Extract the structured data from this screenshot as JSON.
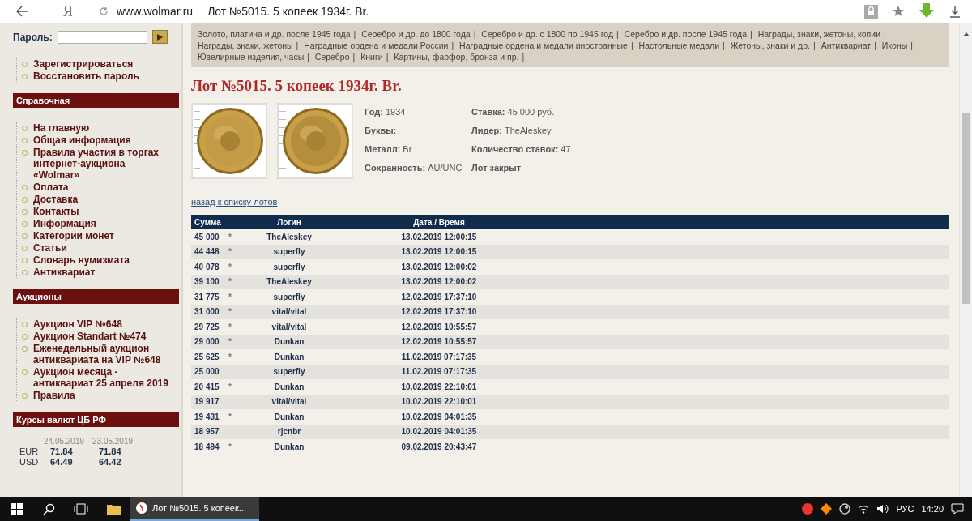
{
  "browser": {
    "logo": "Я",
    "url": "www.wolmar.ru",
    "title": "Лот №5015. 5 копеек 1934г. Br."
  },
  "sidebar": {
    "password_label": "Пароль:",
    "account_links": [
      "Зарегистрироваться",
      "Восстановить пароль"
    ],
    "sections": [
      {
        "title": "Справочная",
        "items": [
          "На главную",
          "Общая информация",
          "Правила участия в торгах интернет-аукциона «Wolmar»",
          "Оплата",
          "Доставка",
          "Контакты",
          "Информация",
          "Категории монет",
          "Статьи",
          "Словарь нумизмата",
          "Антиквариат"
        ]
      },
      {
        "title": "Аукционы",
        "items": [
          "Аукцион VIP №648",
          "Аукцион Standart №474",
          "Еженедельный аукцион антиквариата на VIP №648",
          "Аукцион месяца - антиквариат 25 апреля 2019",
          "Правила"
        ]
      }
    ],
    "rates": {
      "title": "Курсы валют ЦБ РФ",
      "dates": [
        "24.05.2019",
        "23.05.2019"
      ],
      "rows": [
        {
          "currency": "EUR",
          "values": [
            "71.84",
            "71.84"
          ]
        },
        {
          "currency": "USD",
          "values": [
            "64.49",
            "64.42"
          ]
        }
      ]
    }
  },
  "categories": {
    "separator": "|",
    "items": [
      "Золото, платина и др. после 1945 года",
      "Серебро и др. до 1800 года",
      "Серебро и др. с 1800 по 1945 год",
      "Серебро и др. после 1945 года",
      "Награды, знаки, жетоны, копии",
      "Награды, знаки, жетоны",
      "Наградные ордена и медали России",
      "Наградные ордена и медали иностранные",
      "Настольные медали",
      "Жетоны, знаки и др.",
      "Антиквариат",
      "Иконы",
      "Ювелирные изделия, часы",
      "Серебро",
      "Книги",
      "Картины, фарфор, бронза и пр."
    ]
  },
  "lot": {
    "title": "Лот №5015.  5 копеек 1934г. Br.",
    "details_left": [
      {
        "label": "Год:",
        "value": "1934"
      },
      {
        "label": "Буквы:"
      },
      {
        "label": "Металл:",
        "value": "Br"
      },
      {
        "label": "Сохранность:",
        "value": "AU/UNC"
      }
    ],
    "details_right": [
      {
        "label": "Ставка:",
        "value": "45 000 руб."
      },
      {
        "label": "Лидер:",
        "value": "TheAleskey"
      },
      {
        "label": "Количество ставок:",
        "value": "47"
      },
      {
        "label": "Лот закрыт"
      }
    ],
    "back_link": "назад к списку лотов"
  },
  "bids": {
    "columns": [
      "Сумма",
      "Логин",
      "Дата / Время"
    ],
    "rows": [
      {
        "amount": "45 000",
        "star": "*",
        "login": "TheAleskey",
        "datetime": "13.02.2019 12:00:15"
      },
      {
        "amount": "44 448",
        "star": "*",
        "login": "superfly",
        "datetime": "13.02.2019 12:00:15"
      },
      {
        "amount": "40 078",
        "star": "*",
        "login": "superfly",
        "datetime": "13.02.2019 12:00:02"
      },
      {
        "amount": "39 100",
        "star": "*",
        "login": "TheAleskey",
        "datetime": "13.02.2019 12:00:02"
      },
      {
        "amount": "31 775",
        "star": "*",
        "login": "superfly",
        "datetime": "12.02.2019 17:37:10"
      },
      {
        "amount": "31 000",
        "star": "*",
        "login": "vital/vital",
        "datetime": "12.02.2019 17:37:10"
      },
      {
        "amount": "29 725",
        "star": "*",
        "login": "vital/vital",
        "datetime": "12.02.2019 10:55:57"
      },
      {
        "amount": "29 000",
        "star": "*",
        "login": "Dunkan",
        "datetime": "12.02.2019 10:55:57"
      },
      {
        "amount": "25 625",
        "star": "*",
        "login": "Dunkan",
        "datetime": "11.02.2019 07:17:35"
      },
      {
        "amount": "25 000",
        "login": "superfly",
        "datetime": "11.02.2019 07:17:35"
      },
      {
        "amount": "20 415",
        "star": "*",
        "login": "Dunkan",
        "datetime": "10.02.2019 22:10:01"
      },
      {
        "amount": "19 917",
        "login": "vital/vital",
        "datetime": "10.02.2019 22:10:01"
      },
      {
        "amount": "19 431",
        "star": "*",
        "login": "Dunkan",
        "datetime": "10.02.2019 04:01:35"
      },
      {
        "amount": "18 957",
        "login": "rjcnbr",
        "datetime": "10.02.2019 04:01:35"
      },
      {
        "amount": "18 494",
        "star": "*",
        "login": "Dunkan",
        "datetime": "09.02.2019 20:43:47"
      }
    ]
  },
  "taskbar": {
    "window_title": "Лот №5015. 5 копеек...",
    "language": "РУС",
    "time": "14:20"
  }
}
